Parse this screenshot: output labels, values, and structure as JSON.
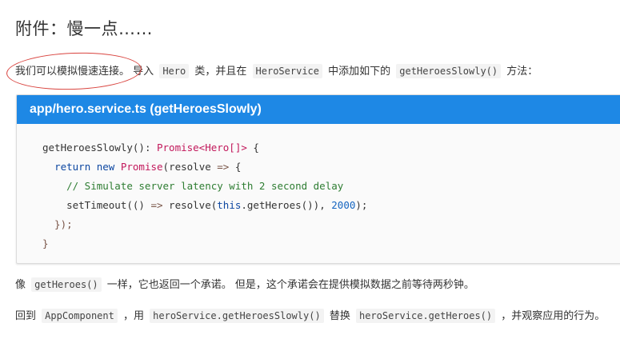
{
  "heading": "附件：慢一点……",
  "intro": {
    "circled_text": "我们可以模拟慢速连接。",
    "t1": "导入",
    "code_hero": "Hero",
    "t2": "类，并且在",
    "code_heroservice": "HeroService",
    "t3": "中添加如下的",
    "code_method": "getHeroesSlowly()",
    "t4": "方法："
  },
  "code_panel": {
    "title": "app/hero.service.ts (getHeroesSlowly)",
    "lines": [
      "getHeroesSlowly(): Promise<Hero[]> {",
      "  return new Promise(resolve => {",
      "    // Simulate server latency with 2 second delay",
      "    setTimeout(() => resolve(this.getHeroes()), 2000);",
      "  });",
      "}"
    ]
  },
  "para2": {
    "t1": "像",
    "code_getheroes": "getHeroes()",
    "t2": "一样，它也返回一个承诺。 但是，这个承诺会在提供模拟数据之前等待两秒钟。"
  },
  "para3": {
    "t1": "回到",
    "code_appcomponent": "AppComponent",
    "t2": "，用",
    "code_slowly": "heroService.getHeroesSlowly()",
    "t3": "替换",
    "code_getheroes": "heroService.getHeroes()",
    "t4": "，并观察应用的行为。"
  },
  "colors": {
    "header_bg": "#1e88e5",
    "circle": "#d9443f"
  }
}
